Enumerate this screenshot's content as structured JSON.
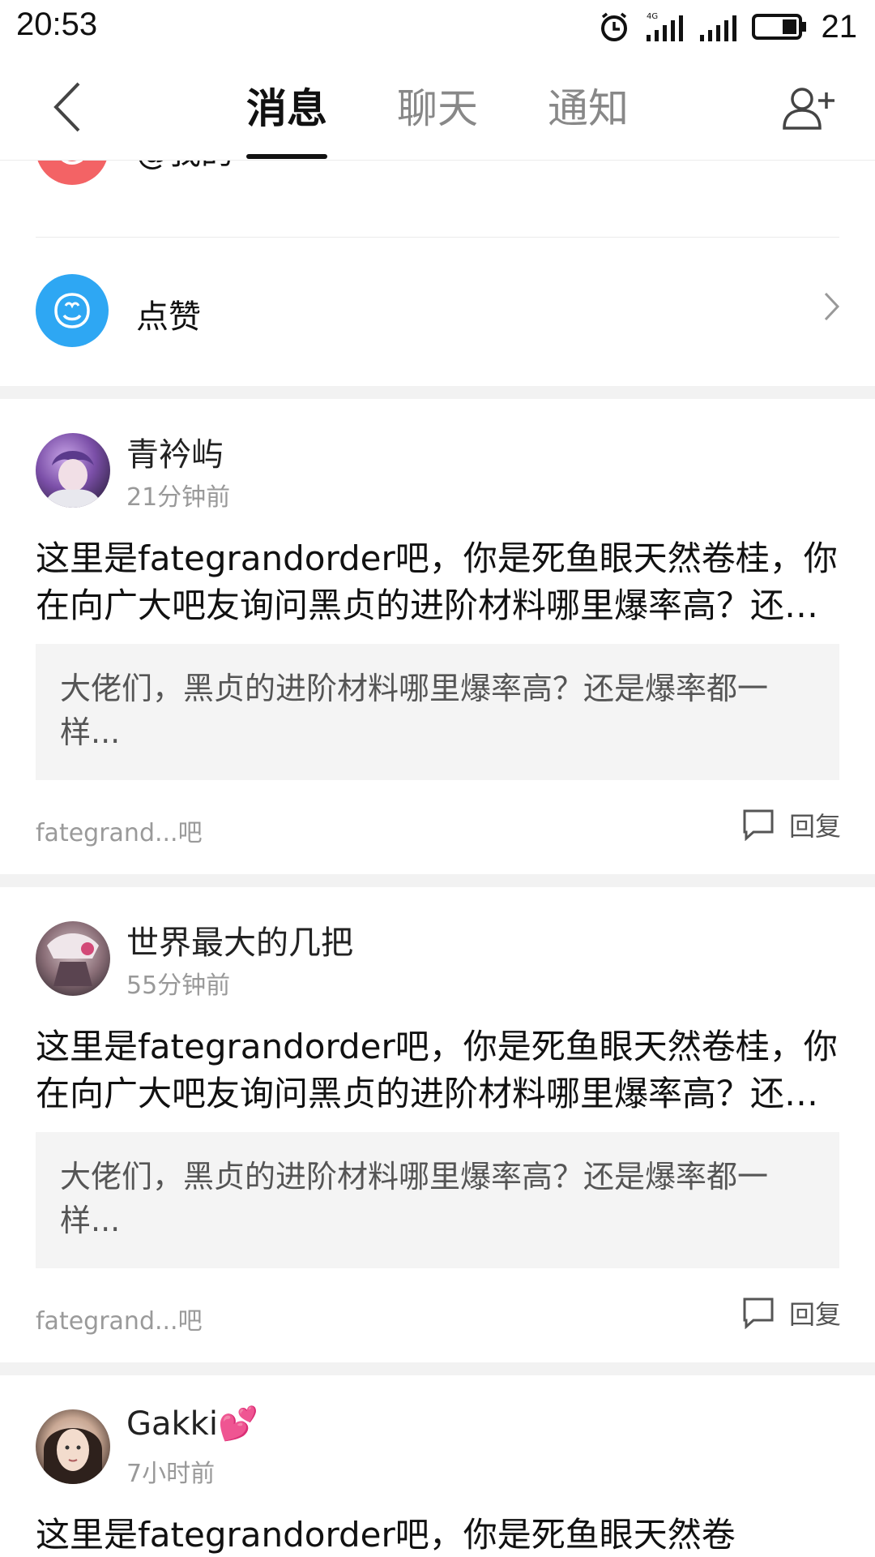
{
  "status_bar": {
    "time": "20:53",
    "battery_level": "21",
    "network": "4G"
  },
  "nav": {
    "tabs": [
      {
        "label": "消息",
        "active": true
      },
      {
        "label": "聊天",
        "active": false
      },
      {
        "label": "通知",
        "active": false
      }
    ],
    "back_icon": "chevron-left-icon",
    "add_icon": "add-friend-icon"
  },
  "menu": {
    "at_me": {
      "label": "@我的",
      "icon": "at-icon",
      "color": "#f36365"
    },
    "likes": {
      "label": "点赞",
      "icon": "thumbs-up-icon",
      "color": "#2ea7f3"
    }
  },
  "posts": [
    {
      "username": "青衿屿",
      "time": "21分钟前",
      "reply": " 这里是fategrandorder吧，你是死鱼眼天然卷桂，你在向广大吧友询问黑贞的进阶材料哪里爆率高？还是爆率都一样",
      "quote": "大佬们，黑贞的进阶材料哪里爆率高？还是爆率都一样...",
      "forum": "fategrand...吧",
      "reply_label": "回复"
    },
    {
      "username": "世界最大的几把",
      "time": "55分钟前",
      "reply": "  这里是fategrandorder吧，你是死鱼眼天然卷桂，你在向广大吧友询问黑贞的进阶材料哪里爆率高？还是爆率都一样",
      "quote": "大佬们，黑贞的进阶材料哪里爆率高？还是爆率都一样...",
      "forum": "fategrand...吧",
      "reply_label": "回复"
    },
    {
      "username": "Gakki💕",
      "time": "7小时前",
      "reply": " 这里是fategrandorder吧，你是死鱼眼天然卷",
      "quote": "",
      "forum": "",
      "reply_label": ""
    }
  ],
  "colors": {
    "accent_text": "#111111",
    "muted_text": "#999999",
    "quote_bg": "#f4f4f4",
    "divider": "#f2f2f2"
  }
}
